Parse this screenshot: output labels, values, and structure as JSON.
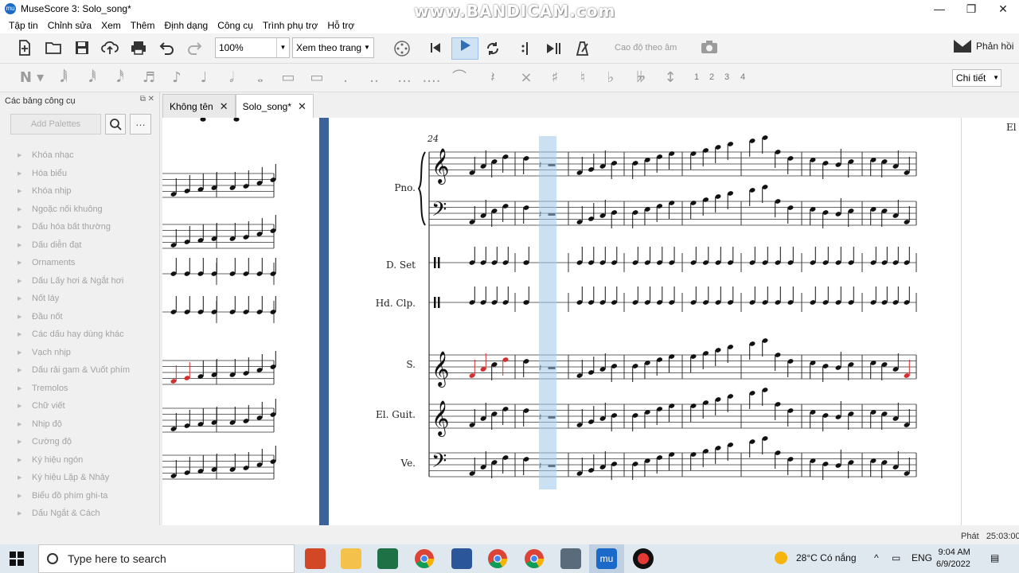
{
  "window": {
    "title": "MuseScore 3: Solo_song*",
    "watermark": "www.BANDICAM.com",
    "controls": [
      "—",
      "❐",
      "✕"
    ]
  },
  "menu": [
    "Tập tin",
    "Chỉnh sửa",
    "Xem",
    "Thêm",
    "Định dạng",
    "Công cụ",
    "Trình phụ trợ",
    "Hỗ trợ"
  ],
  "toolbar": {
    "zoom": "100%",
    "view_mode": "Xem theo trang",
    "pitch_label": "Cao độ theo âm",
    "feedback": "Phản hồi"
  },
  "note_toolbar": {
    "voices": [
      "1",
      "2",
      "3",
      "4"
    ],
    "mode": "Chi tiết"
  },
  "palettes": {
    "title": "Các bảng công cụ",
    "add_button": "Add Palettes",
    "items": [
      "Khóa nhạc",
      "Hóa biểu",
      "Khóa nhịp",
      "Ngoặc nối khuông",
      "Dấu hóa bất thường",
      "Dấu diễn đạt",
      "Ornaments",
      "Dấu Lấy hơi & Ngắt hơi",
      "Nốt láy",
      "Đầu nốt",
      "Các dấu hay dùng khác",
      "Vạch nhịp",
      "Dấu rải gam & Vuốt phím",
      "Tremolos",
      "Chữ viết",
      "Nhịp độ",
      "Cường độ",
      "Ký hiệu ngón",
      "Ký hiệu Lặp & Nhảy",
      "Biểu đồ phím ghi-ta",
      "Dấu Ngắt & Cách"
    ]
  },
  "tabs": [
    {
      "label": "Không tên",
      "active": false
    },
    {
      "label": "Solo_song*",
      "active": true
    }
  ],
  "score": {
    "measure_number": "24",
    "instruments": [
      "Pno.",
      "D. Set",
      "Hd. Clp.",
      "S.",
      "El. Guit.",
      "Ve."
    ],
    "right_edge_label": "El"
  },
  "status": {
    "mode": "Phát",
    "time": "25:03:00"
  },
  "taskbar": {
    "search_placeholder": "Type here to search",
    "weather": "28°C  Có nắng",
    "language": "ENG",
    "time": "9:04 AM",
    "date": "6/9/2022"
  }
}
